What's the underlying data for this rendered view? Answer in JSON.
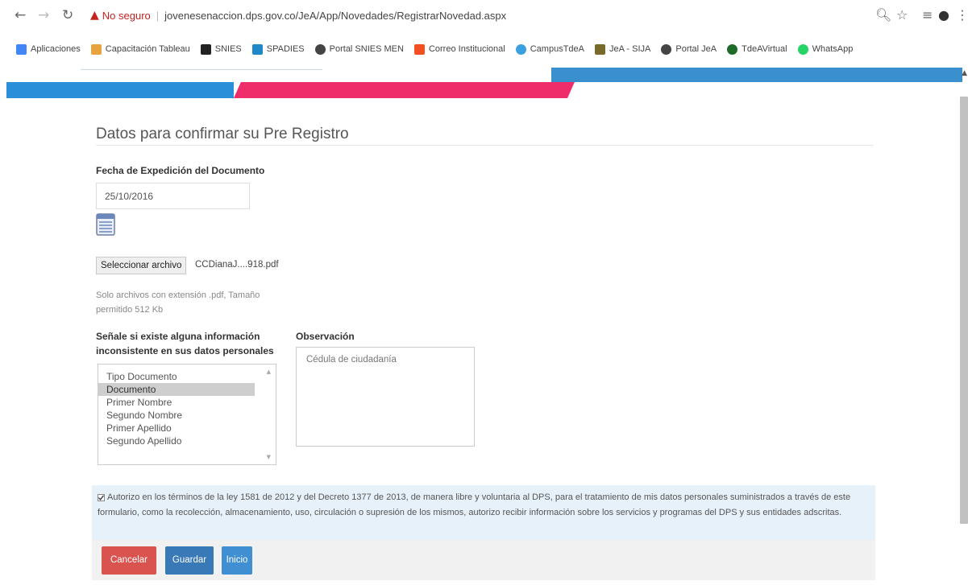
{
  "browser": {
    "not_secure": "No seguro",
    "url": "jovenesenaccion.dps.gov.co/JeA/App/Novedades/RegistrarNovedad.aspx",
    "bookmarks": [
      {
        "label": "Aplicaciones",
        "icon": "apps-grid-icon",
        "color": "#4285f4"
      },
      {
        "label": "Capacitación Tableau",
        "icon": "tableau-icon",
        "color": "#e8a33d"
      },
      {
        "label": "SNIES",
        "icon": "cloud-icon",
        "color": "#222222"
      },
      {
        "label": "SPADIES",
        "icon": "spadies-icon",
        "color": "#1e88c8"
      },
      {
        "label": "Portal SNIES MEN",
        "icon": "globe-icon",
        "color": "#444444"
      },
      {
        "label": "Correo Institucional",
        "icon": "microsoft-icon",
        "color": "#f25022"
      },
      {
        "label": "CampusTdeA",
        "icon": "campus-icon",
        "color": "#3aa0e0"
      },
      {
        "label": "JeA - SIJA",
        "icon": "jea-icon",
        "color": "#7a6a2a"
      },
      {
        "label": "Portal JeA",
        "icon": "globe-icon",
        "color": "#444444"
      },
      {
        "label": "TdeAVirtual",
        "icon": "tdea-icon",
        "color": "#1f6b2a"
      },
      {
        "label": "WhatsApp",
        "icon": "whatsapp-icon",
        "color": "#25d366"
      }
    ]
  },
  "form": {
    "title": "Datos para confirmar su Pre Registro",
    "fecha_label": "Fecha de Expedición del Documento",
    "fecha_value": "25/10/2016",
    "file_button": "Seleccionar archivo",
    "file_name": "CCDianaJ....918.pdf",
    "file_help": "Solo archivos con extensión .pdf, Tamaño permitido 512 Kb",
    "inconsistent_label": "Señale si existe alguna información inconsistente en sus datos personales",
    "list_options": [
      "Tipo Documento",
      "Documento",
      "Primer Nombre",
      "Segundo Nombre",
      "Primer Apellido",
      "Segundo Apellido"
    ],
    "selected_index": 1,
    "observacion_label": "Observación",
    "observacion_value": "Cédula de ciudadanía",
    "consent_text": "Autorizo en los términos de la ley 1581 de 2012 y del Decreto 1377 de 2013, de manera libre y voluntaria al DPS, para el tratamiento de mis datos personales suministrados a través de este formulario, como la recolección, almacenamiento, uso, circulación o supresión de los mismos, autorizo recibir información sobre los servicios y programas del DPS y sus entidades adscritas.",
    "consent_checked": true
  },
  "buttons": {
    "cancel": "Cancelar",
    "save": "Guardar",
    "home": "Inicio"
  },
  "colors": {
    "cancel": "#d9534f",
    "save": "#3a79b8",
    "home": "#3f8fd2",
    "banner_blue": "#2a8fd9",
    "banner_pink": "#ef2d6a"
  }
}
